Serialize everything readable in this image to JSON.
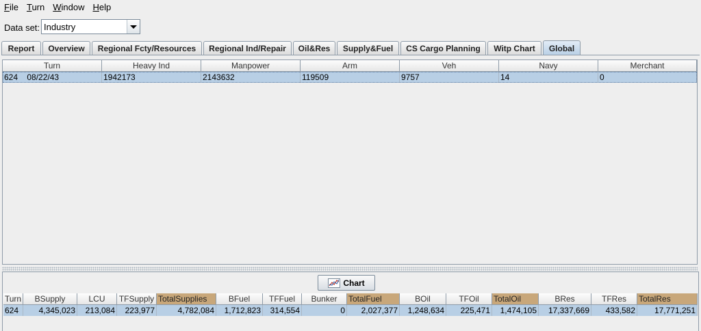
{
  "menu": [
    {
      "mn": "F",
      "rest": "ile"
    },
    {
      "mn": "T",
      "rest": "urn"
    },
    {
      "mn": "W",
      "rest": "indow"
    },
    {
      "mn": "H",
      "rest": "elp"
    }
  ],
  "dataset": {
    "label": "Data set:",
    "value": "Industry"
  },
  "tabs": [
    "Report",
    "Overview",
    "Regional Fcty/Resources",
    "Regional Ind/Repair",
    "Oil&Res",
    "Supply&Fuel",
    "CS Cargo Planning",
    "Witp Chart",
    "Global"
  ],
  "active_tab": "Global",
  "top_table": {
    "headers": [
      "Turn",
      "Heavy Ind",
      "Manpower",
      "Arm",
      "Veh",
      "Navy",
      "Merchant"
    ],
    "rows": [
      [
        "624    08/22/43",
        "1942173",
        "2143632",
        "119509",
        "9757",
        "14",
        "0"
      ]
    ]
  },
  "chart_button": {
    "label": "Chart"
  },
  "bottom_table": {
    "headers": [
      "Turn",
      "BSupply",
      "LCU",
      "TFSupply",
      "TotalSupplies",
      "BFuel",
      "TFFuel",
      "Bunker",
      "TotalFuel",
      "BOil",
      "TFOil",
      "TotalOil",
      "BRes",
      "TFRes",
      "TotalRes"
    ],
    "highlighted_headers": [
      "TotalSupplies",
      "TotalFuel",
      "TotalOil",
      "TotalRes"
    ],
    "rows": [
      [
        "624",
        "4,345,023",
        "213,084",
        "223,977",
        "4,782,084",
        "1,712,823",
        "314,554",
        "0",
        "2,027,377",
        "1,248,634",
        "225,471",
        "1,474,105",
        "17,337,669",
        "433,582",
        "17,771,251"
      ]
    ]
  },
  "colors": {
    "selection": "#b8cfe5",
    "highlight_header": "#c8a77a"
  }
}
